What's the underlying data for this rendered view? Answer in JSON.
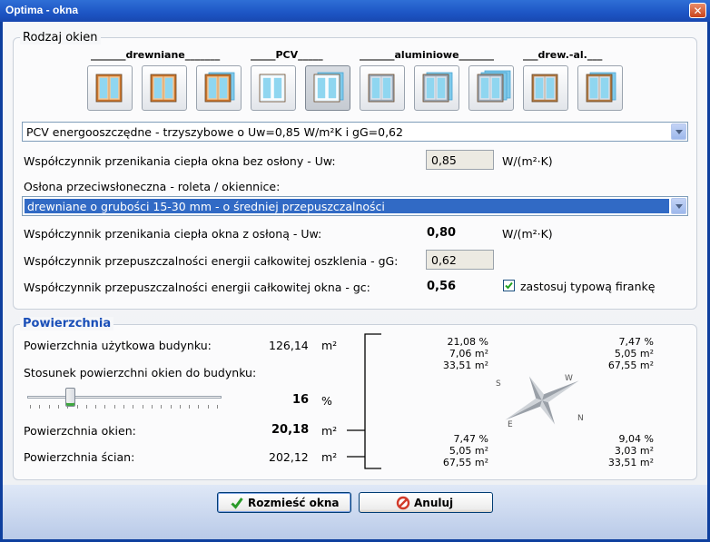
{
  "window": {
    "title": "Optima - okna",
    "close_glyph": "✕"
  },
  "rodzaj": {
    "group_label": "Rodzaj okien",
    "categories": [
      "_______drewniane_______",
      "_____PCV_____",
      "_______aluminiowe_______",
      "___drew.-al.___"
    ],
    "buttons": [
      "window-wood-1-icon",
      "window-wood-2-icon",
      "window-wood-3-icon",
      "window-pcv-1-icon",
      "window-pcv-2-icon",
      "window-alu-1-icon",
      "window-alu-2-icon",
      "window-alu-3-icon",
      "window-wood-alu-1-icon",
      "window-wood-alu-2-icon"
    ],
    "selected_button_index": 4,
    "window_type_selected": "PCV energooszczędne - trzyszybowe o Uw=0,85 W/m²K i gG=0,62",
    "uw_label": "Współczynnik przenikania ciepła okna bez osłony - Uw:",
    "uw_value": "0,85",
    "uw_unit": "W/(m²·K)",
    "oslona_label": "Osłona przeciwsłoneczna - roleta / okiennice:",
    "oslona_selected": "drewniane o grubości 15-30 mm - o średniej przepuszczalności",
    "uw2_label": "Współczynnik przenikania ciepła okna z osłoną - Uw:",
    "uw2_value": "0,80",
    "uw2_unit": "W/(m²·K)",
    "gg_label": "Współczynnik przepuszczalności energii całkowitej oszklenia - gG:",
    "gg_value": "0,62",
    "gc_label": "Współczynnik przepuszczalności energii całkowitej okna - gc:",
    "gc_value": "0,56",
    "firanka_label": "zastosuj typową firankę",
    "firanka_checked": true
  },
  "powierzchnia": {
    "group_label": "Powierzchnia",
    "uzytkowa_label": "Powierzchnia użytkowa budynku:",
    "uzytkowa_value": "126,14",
    "uzytkowa_unit": "m²",
    "stosunek_label": "Stosunek powierzchni okien do budynku:",
    "stosunek_value": "16",
    "stosunek_unit": "%",
    "slider_fraction": 0.2,
    "okien_label": "Powierzchnia okien:",
    "okien_value": "20,18",
    "okien_unit": "m²",
    "scian_label": "Powierzchnia ścian:",
    "scian_value": "202,12",
    "scian_unit": "m²",
    "quadrants": {
      "tl": {
        "pct": "21,08 %",
        "win": "7,06 m²",
        "wall": "33,51 m²"
      },
      "tr": {
        "pct": "7,47 %",
        "win": "5,05 m²",
        "wall": "67,55 m²"
      },
      "bl": {
        "pct": "7,47 %",
        "win": "5,05 m²",
        "wall": "67,55 m²"
      },
      "br": {
        "pct": "9,04 %",
        "win": "3,03 m²",
        "wall": "33,51 m²"
      }
    },
    "compass": {
      "S": "S",
      "W": "W",
      "E": "E",
      "N": "N"
    }
  },
  "buttons": {
    "ok": "Rozmieść okna",
    "cancel": "Anuluj"
  },
  "colors": {
    "title_bar": "#1d55c4",
    "group_title": "#1a4fb8",
    "selection": "#316ac5",
    "ok_icon": "#2a9a2a",
    "cancel_icon": "#d23a2a"
  }
}
